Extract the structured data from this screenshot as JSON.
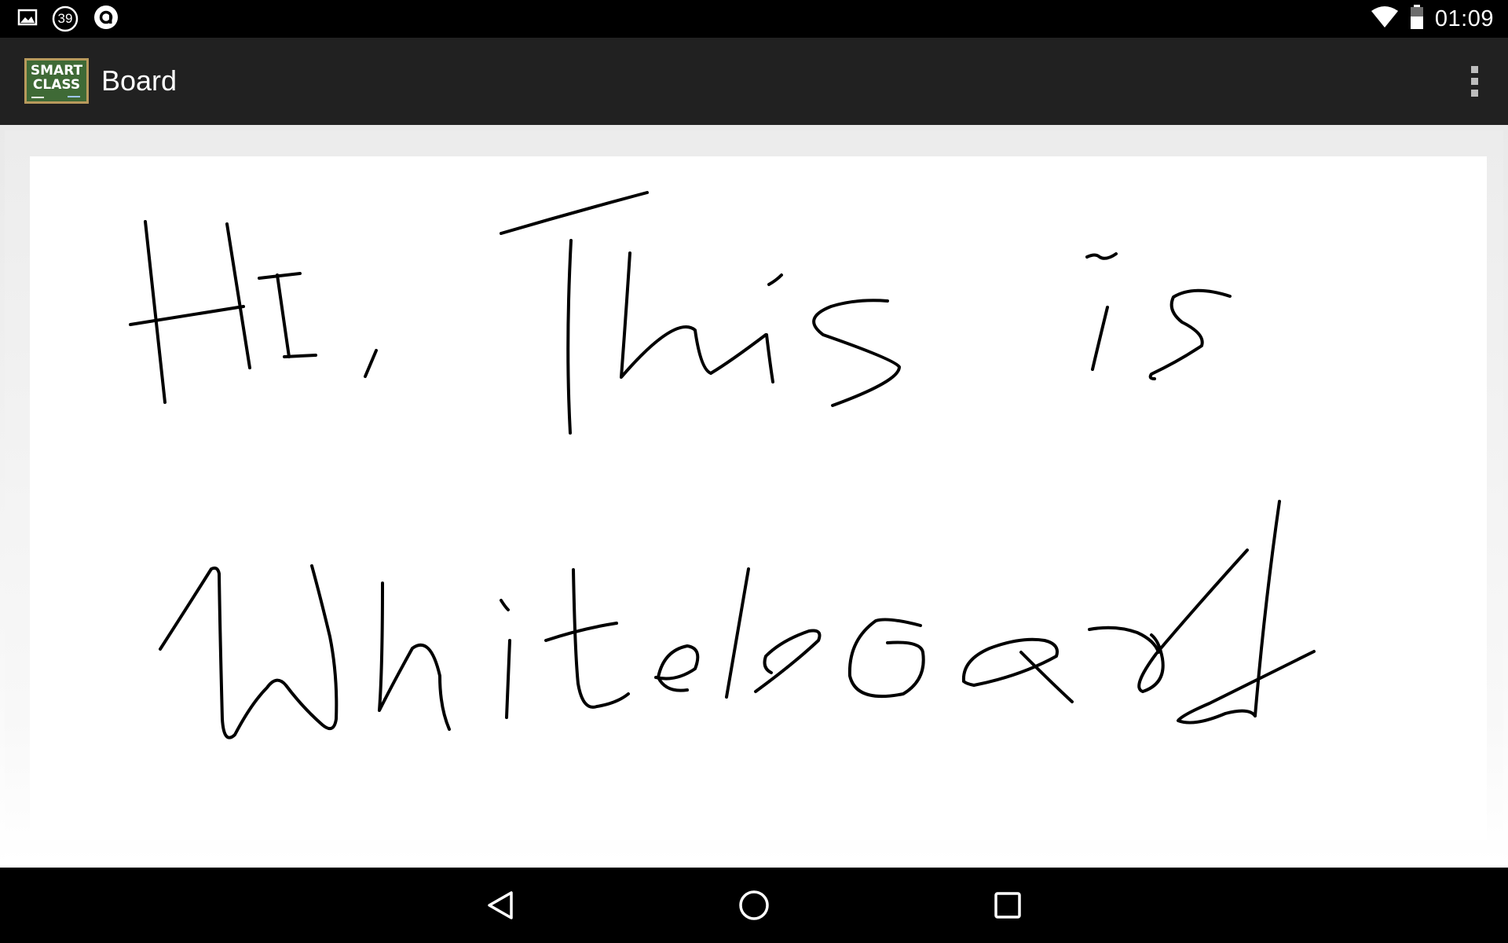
{
  "status_bar": {
    "notification_count": "39",
    "time": "01:09",
    "icons": [
      "image-notification-icon",
      "notification-count-icon",
      "app-notification-icon",
      "wifi-icon",
      "battery-icon"
    ]
  },
  "action_bar": {
    "logo_text_line1": "SMART",
    "logo_text_line2": "CLASS",
    "title": "Board"
  },
  "board": {
    "handwritten_text": [
      "Hi, This is",
      "Whiteboard"
    ]
  },
  "nav_bar": {
    "buttons": [
      "back-icon",
      "home-icon",
      "recents-icon"
    ]
  },
  "colors": {
    "status_bar": "#000000",
    "action_bar": "#212121",
    "board_background": "#ffffff",
    "ink": "#000000"
  }
}
